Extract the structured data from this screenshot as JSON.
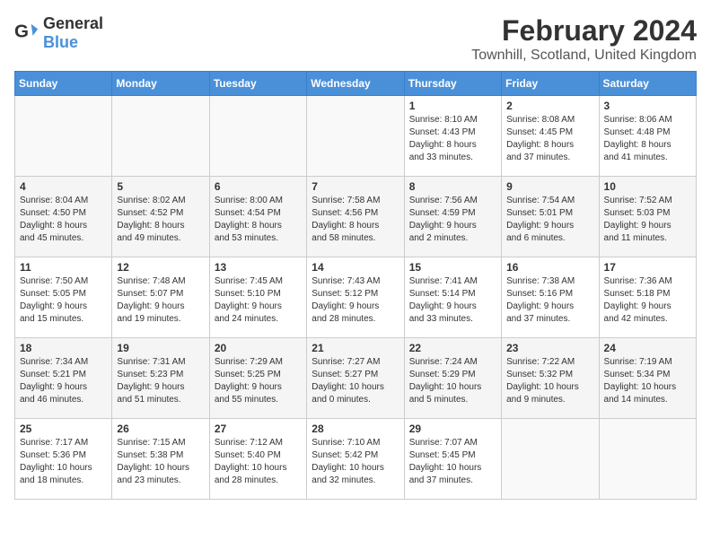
{
  "header": {
    "logo_general": "General",
    "logo_blue": "Blue",
    "month_year": "February 2024",
    "location": "Townhill, Scotland, United Kingdom"
  },
  "days_of_week": [
    "Sunday",
    "Monday",
    "Tuesday",
    "Wednesday",
    "Thursday",
    "Friday",
    "Saturday"
  ],
  "weeks": [
    [
      {
        "day": "",
        "info": ""
      },
      {
        "day": "",
        "info": ""
      },
      {
        "day": "",
        "info": ""
      },
      {
        "day": "",
        "info": ""
      },
      {
        "day": "1",
        "info": "Sunrise: 8:10 AM\nSunset: 4:43 PM\nDaylight: 8 hours\nand 33 minutes."
      },
      {
        "day": "2",
        "info": "Sunrise: 8:08 AM\nSunset: 4:45 PM\nDaylight: 8 hours\nand 37 minutes."
      },
      {
        "day": "3",
        "info": "Sunrise: 8:06 AM\nSunset: 4:48 PM\nDaylight: 8 hours\nand 41 minutes."
      }
    ],
    [
      {
        "day": "4",
        "info": "Sunrise: 8:04 AM\nSunset: 4:50 PM\nDaylight: 8 hours\nand 45 minutes."
      },
      {
        "day": "5",
        "info": "Sunrise: 8:02 AM\nSunset: 4:52 PM\nDaylight: 8 hours\nand 49 minutes."
      },
      {
        "day": "6",
        "info": "Sunrise: 8:00 AM\nSunset: 4:54 PM\nDaylight: 8 hours\nand 53 minutes."
      },
      {
        "day": "7",
        "info": "Sunrise: 7:58 AM\nSunset: 4:56 PM\nDaylight: 8 hours\nand 58 minutes."
      },
      {
        "day": "8",
        "info": "Sunrise: 7:56 AM\nSunset: 4:59 PM\nDaylight: 9 hours\nand 2 minutes."
      },
      {
        "day": "9",
        "info": "Sunrise: 7:54 AM\nSunset: 5:01 PM\nDaylight: 9 hours\nand 6 minutes."
      },
      {
        "day": "10",
        "info": "Sunrise: 7:52 AM\nSunset: 5:03 PM\nDaylight: 9 hours\nand 11 minutes."
      }
    ],
    [
      {
        "day": "11",
        "info": "Sunrise: 7:50 AM\nSunset: 5:05 PM\nDaylight: 9 hours\nand 15 minutes."
      },
      {
        "day": "12",
        "info": "Sunrise: 7:48 AM\nSunset: 5:07 PM\nDaylight: 9 hours\nand 19 minutes."
      },
      {
        "day": "13",
        "info": "Sunrise: 7:45 AM\nSunset: 5:10 PM\nDaylight: 9 hours\nand 24 minutes."
      },
      {
        "day": "14",
        "info": "Sunrise: 7:43 AM\nSunset: 5:12 PM\nDaylight: 9 hours\nand 28 minutes."
      },
      {
        "day": "15",
        "info": "Sunrise: 7:41 AM\nSunset: 5:14 PM\nDaylight: 9 hours\nand 33 minutes."
      },
      {
        "day": "16",
        "info": "Sunrise: 7:38 AM\nSunset: 5:16 PM\nDaylight: 9 hours\nand 37 minutes."
      },
      {
        "day": "17",
        "info": "Sunrise: 7:36 AM\nSunset: 5:18 PM\nDaylight: 9 hours\nand 42 minutes."
      }
    ],
    [
      {
        "day": "18",
        "info": "Sunrise: 7:34 AM\nSunset: 5:21 PM\nDaylight: 9 hours\nand 46 minutes."
      },
      {
        "day": "19",
        "info": "Sunrise: 7:31 AM\nSunset: 5:23 PM\nDaylight: 9 hours\nand 51 minutes."
      },
      {
        "day": "20",
        "info": "Sunrise: 7:29 AM\nSunset: 5:25 PM\nDaylight: 9 hours\nand 55 minutes."
      },
      {
        "day": "21",
        "info": "Sunrise: 7:27 AM\nSunset: 5:27 PM\nDaylight: 10 hours\nand 0 minutes."
      },
      {
        "day": "22",
        "info": "Sunrise: 7:24 AM\nSunset: 5:29 PM\nDaylight: 10 hours\nand 5 minutes."
      },
      {
        "day": "23",
        "info": "Sunrise: 7:22 AM\nSunset: 5:32 PM\nDaylight: 10 hours\nand 9 minutes."
      },
      {
        "day": "24",
        "info": "Sunrise: 7:19 AM\nSunset: 5:34 PM\nDaylight: 10 hours\nand 14 minutes."
      }
    ],
    [
      {
        "day": "25",
        "info": "Sunrise: 7:17 AM\nSunset: 5:36 PM\nDaylight: 10 hours\nand 18 minutes."
      },
      {
        "day": "26",
        "info": "Sunrise: 7:15 AM\nSunset: 5:38 PM\nDaylight: 10 hours\nand 23 minutes."
      },
      {
        "day": "27",
        "info": "Sunrise: 7:12 AM\nSunset: 5:40 PM\nDaylight: 10 hours\nand 28 minutes."
      },
      {
        "day": "28",
        "info": "Sunrise: 7:10 AM\nSunset: 5:42 PM\nDaylight: 10 hours\nand 32 minutes."
      },
      {
        "day": "29",
        "info": "Sunrise: 7:07 AM\nSunset: 5:45 PM\nDaylight: 10 hours\nand 37 minutes."
      },
      {
        "day": "",
        "info": ""
      },
      {
        "day": "",
        "info": ""
      }
    ]
  ]
}
